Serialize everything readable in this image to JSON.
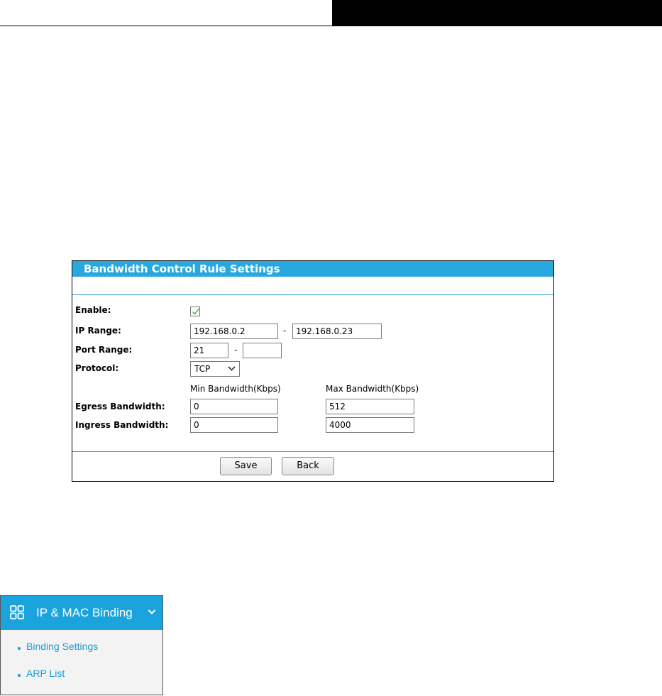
{
  "panel": {
    "title": "Bandwidth Control Rule Settings",
    "enable_label": "Enable:",
    "enable_checked": true,
    "ip_range_label": "IP Range:",
    "ip_start": "192.168.0.2",
    "ip_end": "192.168.0.23",
    "port_range_label": "Port Range:",
    "port_start": "21",
    "port_end": "",
    "range_separator": "-",
    "protocol_label": "Protocol:",
    "protocol_value": "TCP",
    "min_header": "Min Bandwidth(Kbps)",
    "max_header": "Max Bandwidth(Kbps)",
    "egress_label": "Egress Bandwidth:",
    "egress_min": "0",
    "egress_max": "512",
    "ingress_label": "Ingress Bandwidth:",
    "ingress_min": "0",
    "ingress_max": "4000",
    "save_label": "Save",
    "back_label": "Back"
  },
  "menu": {
    "title": "IP & MAC Binding",
    "icon": "grid-icon",
    "items": [
      {
        "label": "Binding Settings"
      },
      {
        "label": "ARP List"
      }
    ]
  },
  "colors": {
    "panel_header": "#29a8df",
    "menu_header": "#1aa3dd",
    "link": "#1a9bd7"
  }
}
